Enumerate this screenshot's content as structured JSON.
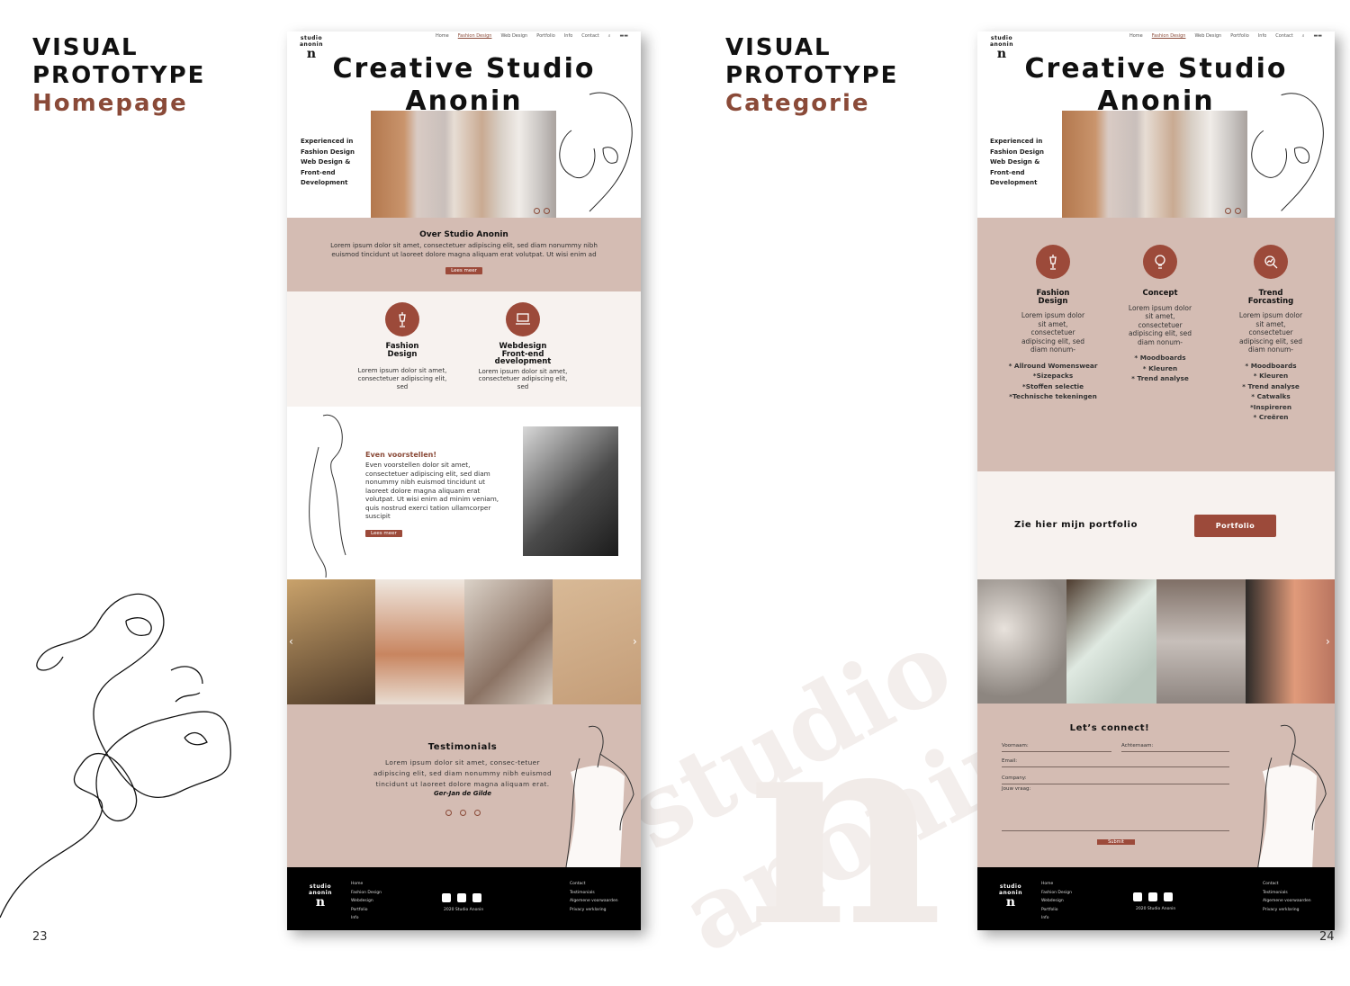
{
  "left_page": {
    "heading_line1": "VISUAL",
    "heading_line2": "PROTOTYPE",
    "heading_sub": "Homepage",
    "page_number": "23"
  },
  "right_page": {
    "heading_line1": "VISUAL",
    "heading_line2": "PROTOTYPE",
    "heading_sub": "Categorie",
    "page_number": "24"
  },
  "nav": {
    "items": [
      "Home",
      "Fashion Design",
      "Web Design",
      "Portfolio",
      "Info",
      "Contact"
    ]
  },
  "logo": {
    "arc": "studio anonin",
    "letter": "n"
  },
  "hero": {
    "title_line1": "Creative Studio",
    "title_line2": "Anonin",
    "side_lines": [
      "Experienced in",
      "Fashion Design",
      "Web Design &",
      "Front-end",
      "Development"
    ]
  },
  "homepage": {
    "about": {
      "title": "Over Studio Anonin",
      "text": "Lorem ipsum dolor sit amet, consectetuer adipiscing elit, sed diam nonummy nibh euismod tincidunt ut laoreet dolore magna aliquam erat volutpat. Ut wisi enim ad",
      "button": "Lees meer"
    },
    "services": [
      {
        "title_line1": "Fashion",
        "title_line2": "Design",
        "title_line3": "",
        "text": "Lorem ipsum dolor sit amet, consectetuer adipiscing elit, sed"
      },
      {
        "title_line1": "Webdesign",
        "title_line2": "Front-end",
        "title_line3": "development",
        "text": "Lorem ipsum dolor sit amet, consectetuer adipiscing elit, sed"
      }
    ],
    "intro": {
      "title": "Even voorstellen!",
      "text": "Even voorstellen dolor sit amet, consectetuer adipiscing elit, sed diam nonummy nibh euismod tincidunt ut laoreet dolore magna aliquam erat volutpat. Ut wisi enim ad minim veniam, quis nostrud exerci tation ullamcorper suscipit",
      "button": "Lees meer"
    },
    "gallery_prev": "‹",
    "gallery_next": "›",
    "testimonials": {
      "title": "Testimonials",
      "text": "Lorem ipsum dolor sit amet, consec-tetuer adipiscing elit, sed diam nonummy nibh euismod tincidunt ut laoreet dolore magna aliquam erat.",
      "author": "Ger-Jan de Gilde"
    }
  },
  "categorie": {
    "columns": [
      {
        "title_line1": "Fashion",
        "title_line2": "Design",
        "text": "Lorem ipsum dolor sit amet, consectetuer adipiscing elit, sed diam nonum-",
        "bullets": [
          "* Allround Womenswear",
          "*Sizepacks",
          "*Stoffen selectie",
          "*Technische tekeningen"
        ]
      },
      {
        "title_line1": "Concept",
        "title_line2": "",
        "text": "Lorem ipsum dolor sit amet, consectetuer adipiscing elit, sed diam nonum-",
        "bullets": [
          "* Moodboards",
          "* Kleuren",
          "* Trend analyse"
        ]
      },
      {
        "title_line1": "Trend",
        "title_line2": "Forcasting",
        "text": "Lorem ipsum dolor sit amet, consectetuer adipiscing elit, sed diam nonum-",
        "bullets": [
          "* Moodboards",
          "* Kleuren",
          "* Trend analyse",
          "* Catwalks",
          "*Inspireren",
          "* Creëren"
        ]
      }
    ],
    "portfolio_text": "Zie hier mijn portfolio",
    "portfolio_button": "Portfolio",
    "gallery_next": "›",
    "connect": {
      "title": "Let’s connect!",
      "firstname": "Voornaam:",
      "lastname": "Achternaam:",
      "email": "Email:",
      "company": "Company:",
      "question": "Jouw vraag:",
      "submit": "Submit"
    }
  },
  "footer": {
    "col1": [
      "Home",
      "Fashion Design",
      "Webdesign",
      "Portfolio",
      "Info"
    ],
    "col2": [
      "Contact",
      "Testimonials",
      "Algemene voorwaarden",
      "Privacy verklaring"
    ],
    "copyright": "2020 Studio Anonin"
  },
  "watermark": {
    "text": "studio anonin",
    "letter": "n"
  },
  "colors": {
    "accent": "#9c4a3a",
    "rose": "#d4bcb3",
    "heading_sub": "#8a4a38"
  }
}
